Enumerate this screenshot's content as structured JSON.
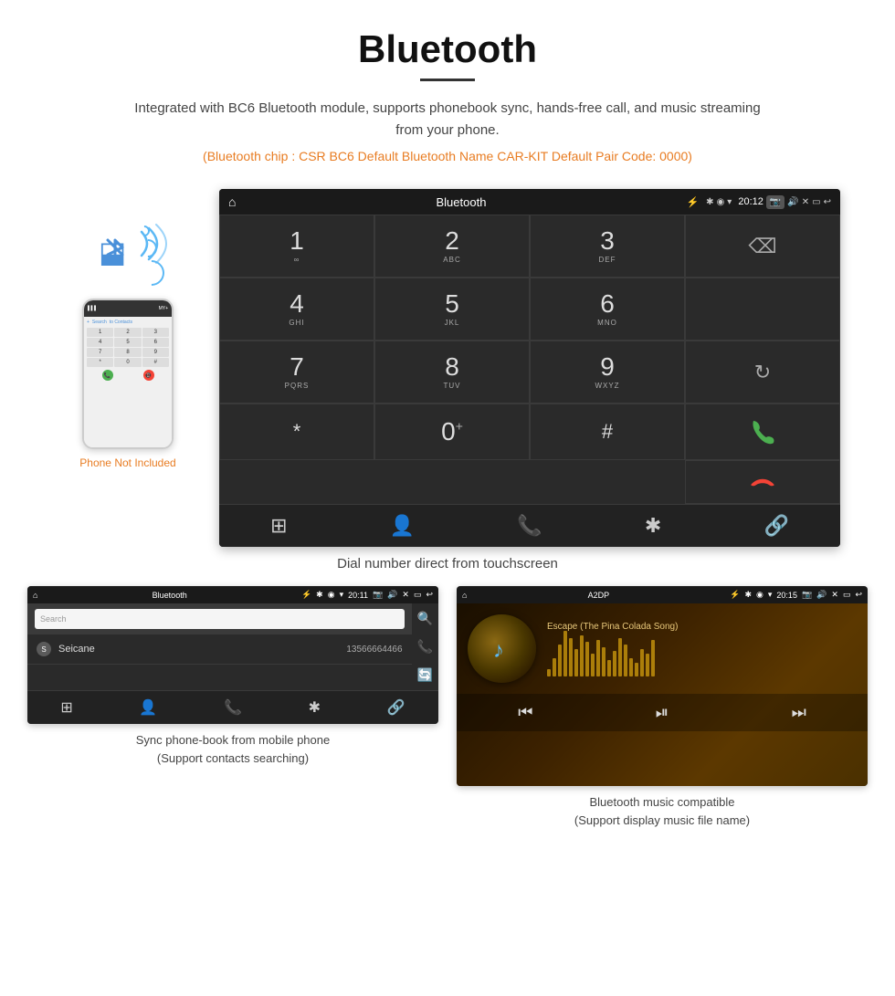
{
  "page": {
    "title": "Bluetooth",
    "description": "Integrated with BC6 Bluetooth module, supports phonebook sync, hands-free call, and music streaming from your phone.",
    "orange_info": "(Bluetooth chip : CSR BC6     Default Bluetooth Name CAR-KIT     Default Pair Code: 0000)",
    "phone_not_included": "Phone Not Included",
    "main_caption": "Dial number direct from touchscreen",
    "bottom_left_caption": "Sync phone-book from mobile phone\n(Support contacts searching)",
    "bottom_right_caption": "Bluetooth music compatible\n(Support display music file name)"
  },
  "car_screen": {
    "status_bar": {
      "title": "Bluetooth",
      "time": "20:12"
    },
    "dialpad": {
      "keys": [
        {
          "number": "1",
          "letters": "∞"
        },
        {
          "number": "2",
          "letters": "ABC"
        },
        {
          "number": "3",
          "letters": "DEF"
        },
        {
          "number": "4",
          "letters": "GHI"
        },
        {
          "number": "5",
          "letters": "JKL"
        },
        {
          "number": "6",
          "letters": "MNO"
        },
        {
          "number": "7",
          "letters": "PQRS"
        },
        {
          "number": "8",
          "letters": "TUV"
        },
        {
          "number": "9",
          "letters": "WXYZ"
        },
        {
          "number": "*",
          "letters": ""
        },
        {
          "number": "0",
          "letters": "+"
        },
        {
          "number": "#",
          "letters": ""
        }
      ]
    },
    "nav_icons": [
      "⊞",
      "👤",
      "📞",
      "✱",
      "🔗"
    ]
  },
  "phonebook_screen": {
    "status_bar": {
      "title": "Bluetooth",
      "time": "20:11"
    },
    "search_placeholder": "Search",
    "contacts": [
      {
        "letter": "S",
        "name": "Seicane",
        "number": "13566664466"
      }
    ],
    "right_icons": [
      "🔍",
      "📞",
      "🔄"
    ],
    "nav_icons": [
      "⊞",
      "👤",
      "📞",
      "✱",
      "🔗"
    ]
  },
  "music_screen": {
    "status_bar": {
      "title": "A2DP",
      "time": "20:15"
    },
    "song_title": "Escape (The Pina Colada Song)",
    "viz_bars": [
      8,
      20,
      35,
      50,
      42,
      30,
      45,
      38,
      25,
      40,
      32,
      18,
      28,
      42,
      35,
      20,
      15,
      30,
      25,
      40
    ],
    "controls": [
      "⏮",
      "⏯",
      "⏭"
    ]
  },
  "colors": {
    "orange": "#e87c22",
    "green": "#4caf50",
    "red": "#f44336",
    "blue": "#4a90d9",
    "screen_bg": "#2a2a2a",
    "status_bg": "#1a1a1a"
  }
}
